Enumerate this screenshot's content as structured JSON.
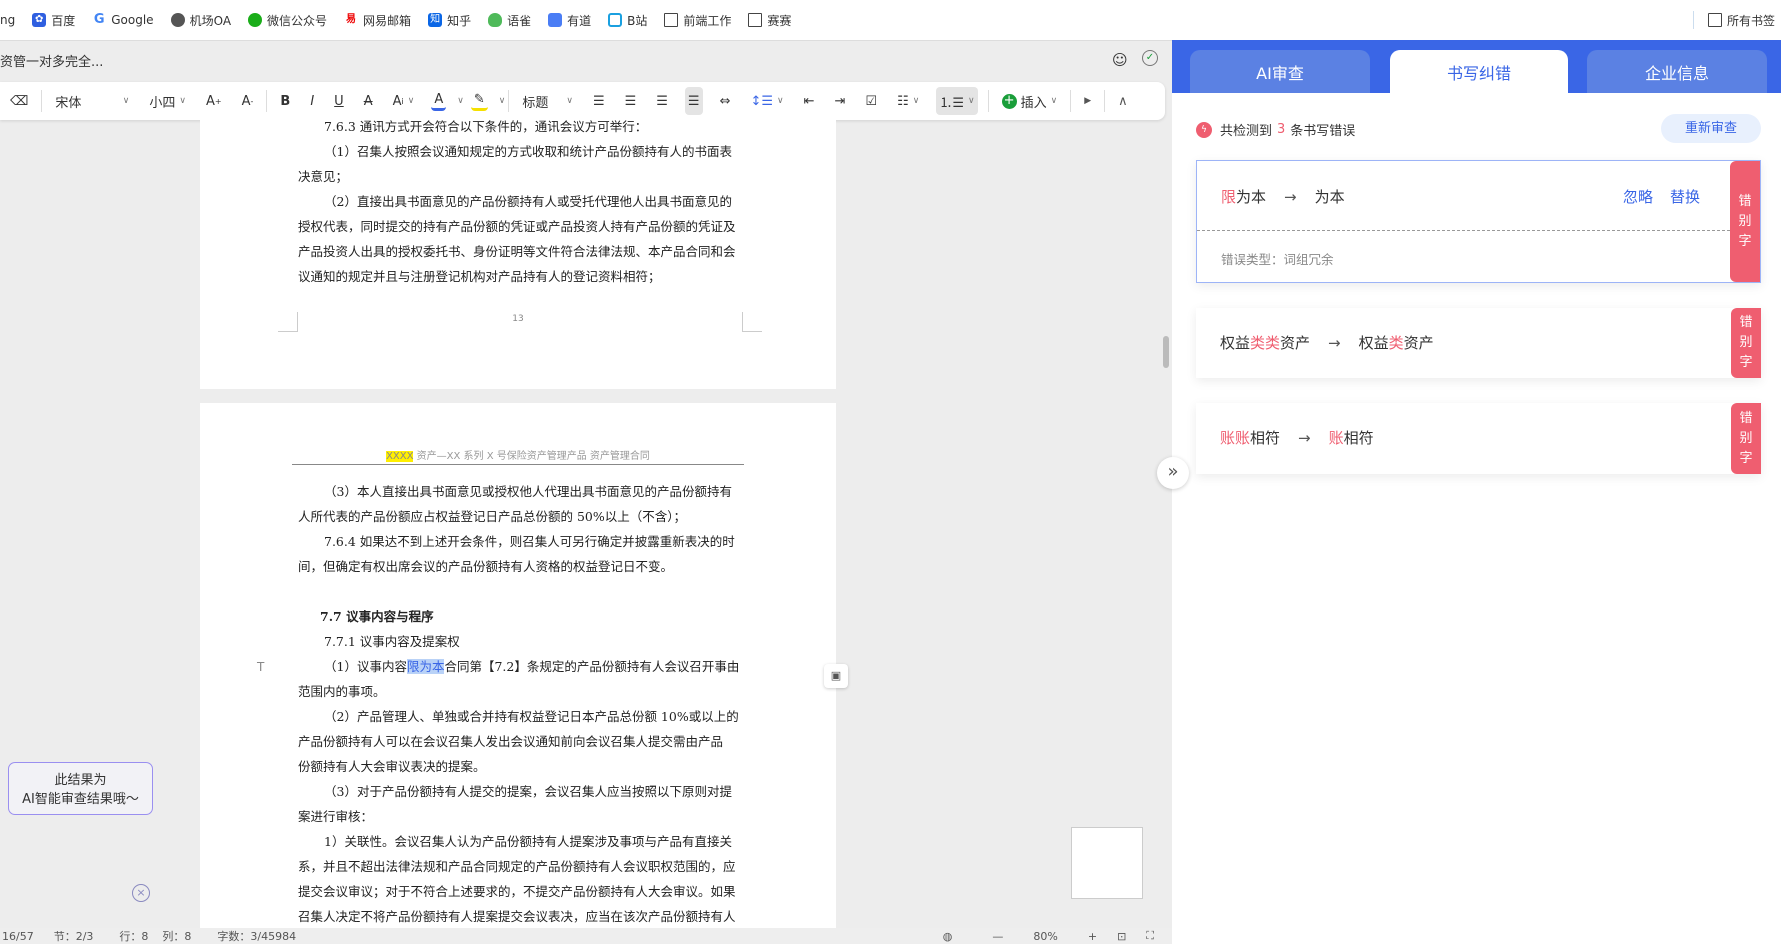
{
  "bookmarks": {
    "items": [
      {
        "label": "ng",
        "icon": "truncated"
      },
      {
        "label": "百度",
        "icon": "baidu-icon"
      },
      {
        "label": "Google",
        "icon": "google-icon"
      },
      {
        "label": "机场OA",
        "icon": "globe-icon"
      },
      {
        "label": "微信公众号",
        "icon": "wechat-icon"
      },
      {
        "label": "网易邮箱",
        "icon": "netease-icon"
      },
      {
        "label": "知乎",
        "icon": "zhihu-icon"
      },
      {
        "label": "语雀",
        "icon": "yuque-icon"
      },
      {
        "label": "有道",
        "icon": "youdao-icon"
      },
      {
        "label": "B站",
        "icon": "bilibili-icon"
      },
      {
        "label": "前端工作",
        "icon": "folder-icon"
      },
      {
        "label": "赛赛",
        "icon": "folder-icon"
      }
    ],
    "all": "所有书签"
  },
  "doc": {
    "title": "资管一对多完全...",
    "toolbar": {
      "font": "宋体",
      "size": "小四",
      "heading": "标题",
      "insert": "插入"
    },
    "page1": {
      "lines": [
        "7.6.3 通讯方式开会符合以下条件的，通讯会议方可举行：",
        "（1）召集人按照会议通知规定的方式收取和统计产品份额持有人的书面表",
        "决意见；",
        "（2）直接出具书面意见的产品份额持有人或受托代理他人出具书面意见的",
        "授权代表，同时提交的持有产品份额的凭证或产品投资人持有产品份额的凭证及",
        "产品投资人出具的授权委托书、身份证明等文件符合法律法规、本产品合同和会",
        "议通知的规定并且与注册登记机构对产品持有人的登记资料相符；"
      ],
      "page_number": "13"
    },
    "page2": {
      "header_highlight": "XXXX",
      "header_rest": "资产—XX 系列 X 号保险资产管理产品  资产管理合同",
      "lines": [
        "（3）本人直接出具书面意见或授权他人代理出具书面意见的产品份额持有",
        "人所代表的产品份额应占权益登记日产品总份额的 50%以上（不含）；",
        "7.6.4 如果达不到上述开会条件，则召集人可另行确定并披露重新表决的时",
        "间，但确定有权出席会议的产品份额持有人资格的权益登记日不变。",
        "7.7  议事内容与程序",
        "7.7.1 议事内容及提案权",
        "（1）议事内容",
        "限为本",
        "合同第【7.2】条规定的产品份额持有人会议召开事由",
        "范围内的事项。",
        "（2）产品管理人、单独或合并持有权益登记日本产品总份额 10%或以上的",
        "产品份额持有人可以在会议召集人发出会议通知前向会议召集人提交需由产品",
        "份额持有人大会审议表决的提案。",
        "（3）对于产品份额持有人提交的提案，会议召集人应当按照以下原则对提",
        "案进行审核：",
        "1）关联性。会议召集人认为产品份额持有人提案涉及事项与产品有直接关",
        "系，并且不超出法律法规和产品合同规定的产品份额持有人会议职权范围的，应",
        "提交会议审议；对于不符合上述要求的，不提交产品份额持有人大会审议。如果",
        "召集人决定不将产品份额持有人提案提交会议表决，应当在该次产品份额持有人"
      ]
    },
    "float_tip": {
      "line1": "此结果为",
      "line2": "AI智能审查结果哦～"
    },
    "status": {
      "page": "16/57",
      "section": "节：2/3",
      "row": "行：8",
      "col": "列：8",
      "words": "字数：3/45984",
      "zoom": "80%"
    }
  },
  "panel": {
    "tabs": [
      {
        "label": "AI审查",
        "active": false
      },
      {
        "label": "书写纠错",
        "active": true
      },
      {
        "label": "企业信息",
        "active": false
      }
    ],
    "summary": {
      "prefix": "共检测到",
      "count": "3",
      "suffix": "条书写错误"
    },
    "recheck": "重新审查",
    "cards": [
      {
        "wrong_red": "限",
        "wrong_rest": "为本",
        "right_red": "",
        "right_rest": "为本",
        "tag": [
          "错",
          "别",
          "字"
        ],
        "ignore": "忽略",
        "replace": "替换",
        "type_label": "错误类型：",
        "type_value": "词组冗余"
      },
      {
        "wrong_pre": "权益",
        "wrong_red": "类类",
        "wrong_post": "资产",
        "right_pre": "权益",
        "right_red": "类",
        "right_post": "资产",
        "tag": [
          "错",
          "别",
          "字"
        ]
      },
      {
        "wrong_red": "账账",
        "wrong_rest": "相符",
        "right_red": "账",
        "right_rest": "相符",
        "tag": [
          "错",
          "别",
          "字"
        ]
      }
    ],
    "colors": {
      "primary": "#3a66e6",
      "error": "#ef5e70"
    }
  }
}
